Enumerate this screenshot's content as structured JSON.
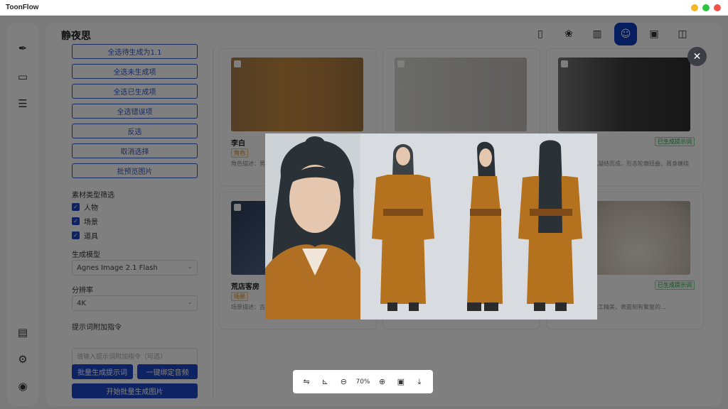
{
  "app": {
    "title": "ToonFlow",
    "window_dots": [
      "#f5b625",
      "#2cc542",
      "#f0524c"
    ]
  },
  "page": {
    "title": "静夜思"
  },
  "left_nav": {
    "top_icons": [
      "quill-icon",
      "folder-icon",
      "document-icon"
    ],
    "bottom_icons": [
      "book-icon",
      "settings-icon",
      "github-icon"
    ]
  },
  "toolbar": {
    "icons": [
      "script-icon",
      "palette-icon",
      "library-icon",
      "character-icon",
      "video-icon",
      "box-icon"
    ],
    "active": "character-icon",
    "accent": "#0b3dbf"
  },
  "panel": {
    "batch_buttons": [
      "全选待生成为1.1",
      "全选未生成项",
      "全选已生成项",
      "全选错误项",
      "反选",
      "取消选择",
      "批预览图片"
    ],
    "type_filter_label": "素材类型筛选",
    "type_filters": [
      "人物",
      "场景",
      "道具"
    ],
    "model_label": "生成模型",
    "model_value": "Agnes Image 2.1 Flash",
    "resolution_label": "分辨率",
    "resolution_value": "4K",
    "prompt_label": "提示词附加指令",
    "prompt_placeholder": "请输入提示词附加指令（可选）",
    "btn_batch_prompt": "批量生成提示词",
    "btn_bind_voice": "一键绑定音频",
    "btn_start": "开始批量生成图片"
  },
  "cards": [
    {
      "name": "李白",
      "tag": "角色",
      "status": "",
      "desc": "角色描述：男…"
    },
    {
      "name": "",
      "tag": "",
      "status": "",
      "desc": ""
    },
    {
      "name": "",
      "tag": "",
      "status": "已生成提示词",
      "desc": "…由黑暗和魔气凝结而成，形态轮廓扭曲，周身缠绕着黑色…"
    },
    {
      "name": "荒店客房",
      "tag": "场景",
      "status": "",
      "desc": "场景描述：古…客栈的破旧…"
    },
    {
      "name": "",
      "tag": "",
      "status": "",
      "desc": ""
    },
    {
      "name": "",
      "tag": "",
      "status": "已生成提示词",
      "desc": "…古白玉佩，雕工精美，表面刻有繁复的…"
    }
  ],
  "viewer": {
    "zoom_label": "70%",
    "zoom_percent": 70,
    "tools": [
      "flip-horizontal-icon",
      "rotate-icon",
      "zoom-out-icon",
      "zoom-in-icon",
      "fit-image-icon",
      "download-icon"
    ]
  }
}
